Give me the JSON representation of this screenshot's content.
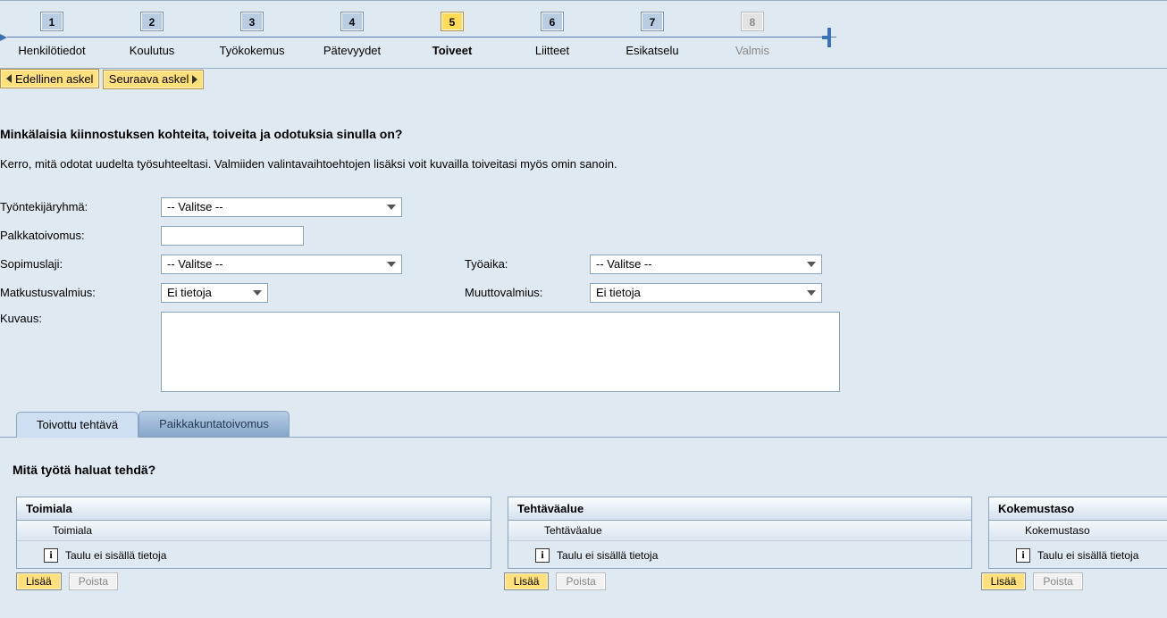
{
  "roadmap": {
    "active_index": 4,
    "steps": [
      {
        "num": "1",
        "label": "Henkilötiedot"
      },
      {
        "num": "2",
        "label": "Koulutus"
      },
      {
        "num": "3",
        "label": "Työkokemus"
      },
      {
        "num": "4",
        "label": "Pätevyydet"
      },
      {
        "num": "5",
        "label": "Toiveet"
      },
      {
        "num": "6",
        "label": "Liitteet"
      },
      {
        "num": "7",
        "label": "Esikatselu"
      },
      {
        "num": "8",
        "label": "Valmis",
        "disabled": true
      }
    ]
  },
  "nav": {
    "prev": "Edellinen askel",
    "next": "Seuraava askel"
  },
  "heading": "Minkälaisia kiinnostuksen kohteita, toiveita ja odotuksia sinulla on?",
  "intro": "Kerro, mitä odotat uudelta työsuhteeltasi.  Valmiiden valintavaihtoehtojen lisäksi voit kuvailla toiveitasi myös omin sanoin.",
  "form": {
    "tyontekija_label": "Työntekijäryhmä:",
    "tyontekija_value": "-- Valitse --",
    "palkka_label": "Palkkatoivomus:",
    "palkka_value": "",
    "sopimus_label": "Sopimuslaji:",
    "sopimus_value": "-- Valitse --",
    "tyoaika_label": "Työaika:",
    "tyoaika_value": "-- Valitse --",
    "matkustus_label": "Matkustusvalmius:",
    "matkustus_value": "Ei tietoja",
    "muutto_label": "Muuttovalmius:",
    "muutto_value": "Ei tietoja",
    "kuvaus_label": "Kuvaus:",
    "kuvaus_value": ""
  },
  "tabs": {
    "tab1": "Toivottu tehtävä",
    "tab2": "Paikkakuntatoivomus"
  },
  "subheading": "Mitä työtä haluat tehdä?",
  "panels": {
    "toimiala": {
      "title": "Toimiala",
      "col": "Toimiala",
      "empty": "Taulu ei sisällä tietoja"
    },
    "tehtavaalue": {
      "title": "Tehtäväalue",
      "col": "Tehtäväalue",
      "empty": "Taulu ei sisällä tietoja"
    },
    "kokemustaso": {
      "title": "Kokemustaso",
      "col": "Kokemustaso",
      "empty": "Taulu ei sisällä tietoja"
    }
  },
  "buttons": {
    "add": "Lisää",
    "remove": "Poista"
  }
}
